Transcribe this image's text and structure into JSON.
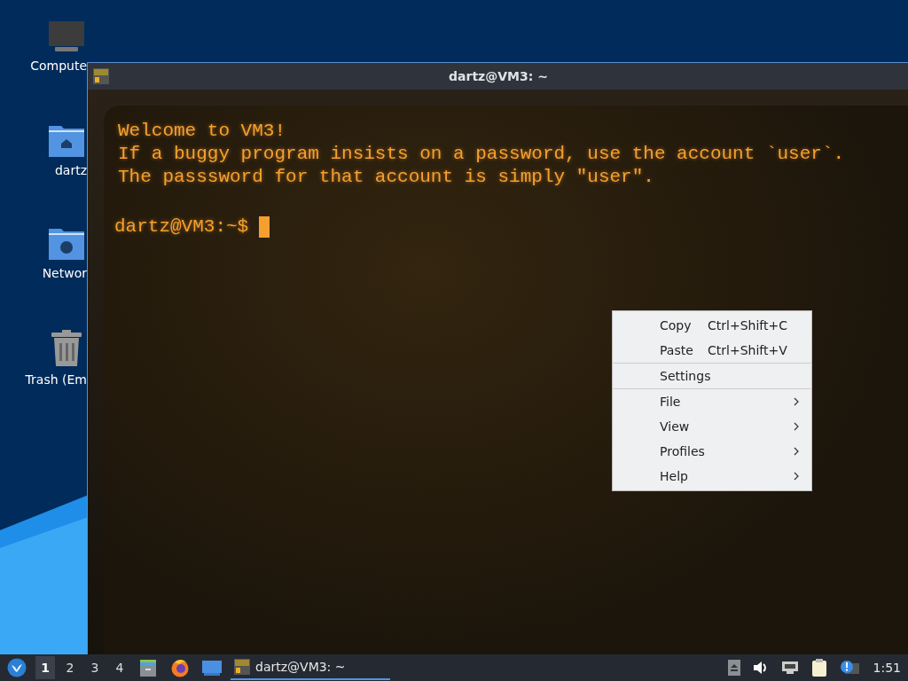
{
  "desktop": {
    "icons": [
      {
        "label": "Compute",
        "kind": "computer"
      },
      {
        "label": "dartz",
        "kind": "home"
      },
      {
        "label": "Networ",
        "kind": "network"
      },
      {
        "label": "Trash (Em",
        "kind": "trash"
      }
    ]
  },
  "window": {
    "title": "dartz@VM3: ~",
    "terminal": {
      "lines": [
        "Welcome to VM3!",
        "If a buggy program insists on a password, use the account `user`.",
        "The passsword for that account is simply \"user\"."
      ],
      "prompt": "dartz@VM3:~$"
    }
  },
  "context_menu": {
    "items": [
      {
        "kind": "action",
        "label": "Copy",
        "shortcut": "Ctrl+Shift+C"
      },
      {
        "kind": "action",
        "label": "Paste",
        "shortcut": "Ctrl+Shift+V"
      },
      {
        "kind": "separator"
      },
      {
        "kind": "action",
        "label": "Settings"
      },
      {
        "kind": "separator"
      },
      {
        "kind": "submenu",
        "label": "File"
      },
      {
        "kind": "submenu",
        "label": "View"
      },
      {
        "kind": "submenu",
        "label": "Profiles"
      },
      {
        "kind": "submenu",
        "label": "Help"
      }
    ]
  },
  "taskbar": {
    "workspaces": [
      {
        "label": "1",
        "selected": true
      },
      {
        "label": "2",
        "selected": false
      },
      {
        "label": "3",
        "selected": false
      },
      {
        "label": "4",
        "selected": false
      }
    ],
    "launchers": [
      {
        "kind": "files"
      },
      {
        "kind": "browser"
      },
      {
        "kind": "desktop"
      }
    ],
    "tasks": [
      {
        "label": "dartz@VM3: ~",
        "selected": true
      }
    ],
    "clock": "1:51"
  }
}
